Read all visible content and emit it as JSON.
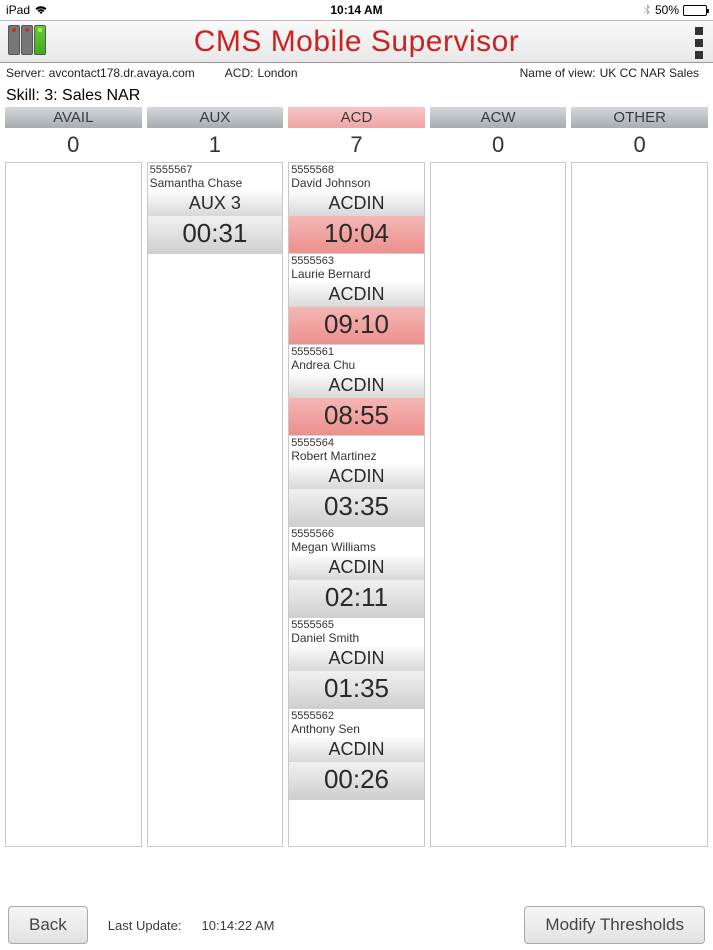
{
  "status": {
    "carrier": "iPad",
    "time": "10:14 AM",
    "battery_pct": "50%"
  },
  "header": {
    "title": "CMS  Mobile Supervisor"
  },
  "info": {
    "server_label": "Server:",
    "server_value": "avcontact178.dr.avaya.com",
    "acd_label": "ACD:",
    "acd_value": "London",
    "view_label": "Name of view:",
    "view_value": "UK CC NAR Sales",
    "skill_label": "Skill:",
    "skill_value": "3: Sales NAR"
  },
  "columns": [
    {
      "key": "avail",
      "label": "AVAIL",
      "count": "0",
      "alert": false,
      "agents": []
    },
    {
      "key": "aux",
      "label": "AUX",
      "count": "1",
      "alert": false,
      "agents": [
        {
          "id": "5555567",
          "name": "Samantha Chase",
          "state": "AUX 3",
          "time": "00:31",
          "time_alert": false
        }
      ]
    },
    {
      "key": "acd",
      "label": "ACD",
      "count": "7",
      "alert": true,
      "agents": [
        {
          "id": "5555568",
          "name": "David Johnson",
          "state": "ACDIN",
          "time": "10:04",
          "time_alert": true
        },
        {
          "id": "5555563",
          "name": "Laurie Bernard",
          "state": "ACDIN",
          "time": "09:10",
          "time_alert": true
        },
        {
          "id": "5555561",
          "name": "Andrea Chu",
          "state": "ACDIN",
          "time": "08:55",
          "time_alert": true
        },
        {
          "id": "5555564",
          "name": "Robert Martinez",
          "state": "ACDIN",
          "time": "03:35",
          "time_alert": false
        },
        {
          "id": "5555566",
          "name": "Megan Williams",
          "state": "ACDIN",
          "time": "02:11",
          "time_alert": false
        },
        {
          "id": "5555565",
          "name": "Daniel Smith",
          "state": "ACDIN",
          "time": "01:35",
          "time_alert": false
        },
        {
          "id": "5555562",
          "name": "Anthony Sen",
          "state": "ACDIN",
          "time": "00:26",
          "time_alert": false
        }
      ]
    },
    {
      "key": "acw",
      "label": "ACW",
      "count": "0",
      "alert": false,
      "agents": []
    },
    {
      "key": "other",
      "label": "OTHER",
      "count": "0",
      "alert": false,
      "agents": []
    }
  ],
  "footer": {
    "back_label": "Back",
    "last_update_label": "Last Update:",
    "last_update_value": "10:14:22 AM",
    "modify_label": "Modify Thresholds"
  }
}
